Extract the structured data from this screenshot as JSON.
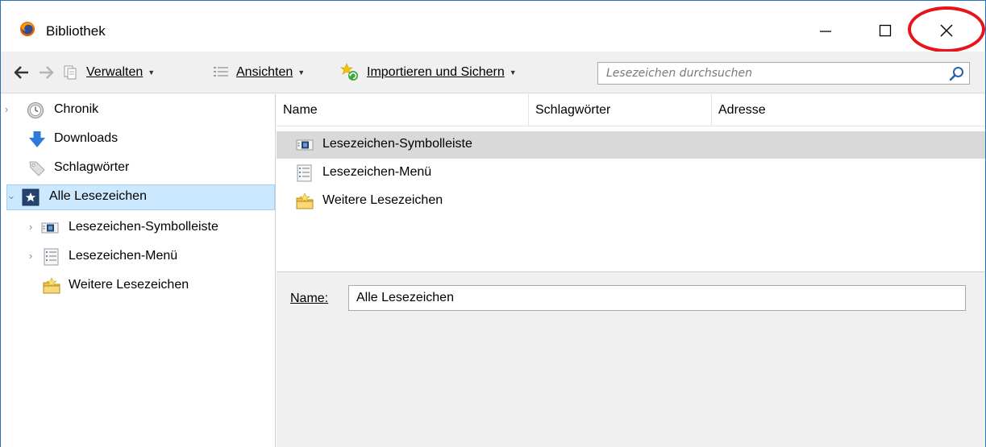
{
  "window": {
    "title": "Bibliothek",
    "icons": {
      "app": "firefox-icon",
      "minimize": "minimize-icon",
      "maximize": "maximize-icon",
      "close": "close-icon"
    },
    "close_highlight_color": "#e8141c"
  },
  "toolbar": {
    "verwalten_label": "Verwalten",
    "ansichten_label": "Ansichten",
    "import_label": "Importieren und Sichern",
    "search_placeholder": "Lesezeichen durchsuchen"
  },
  "sidebar": {
    "items": [
      {
        "label": "Chronik",
        "icon": "clock-icon",
        "expandable": true,
        "expanded": false
      },
      {
        "label": "Downloads",
        "icon": "download-arrow-icon"
      },
      {
        "label": "Schlagwörter",
        "icon": "tag-icon"
      },
      {
        "label": "Alle Lesezeichen",
        "icon": "bookmarks-star-icon",
        "expandable": true,
        "expanded": true,
        "selected": true
      },
      {
        "label": "Lesezeichen-Symbolleiste",
        "icon": "bookmark-toolbar-icon",
        "expandable": true,
        "expanded": false
      },
      {
        "label": "Lesezeichen-Menü",
        "icon": "bookmark-menu-icon",
        "expandable": true,
        "expanded": false
      },
      {
        "label": "Weitere Lesezeichen",
        "icon": "folder-star-icon"
      }
    ]
  },
  "list": {
    "columns": [
      "Name",
      "Schlagwörter",
      "Adresse"
    ],
    "rows": [
      {
        "name": "Lesezeichen-Symbolleiste",
        "icon": "bookmark-toolbar-icon",
        "selected": true
      },
      {
        "name": "Lesezeichen-Menü",
        "icon": "bookmark-menu-icon"
      },
      {
        "name": "Weitere Lesezeichen",
        "icon": "folder-star-icon"
      }
    ]
  },
  "details": {
    "name_label": "Name:",
    "name_value": "Alle Lesezeichen"
  },
  "colors": {
    "selection_sidebar": "#cce8ff",
    "selection_list": "#d9d9d9",
    "window_border": "#2b6fb8"
  }
}
